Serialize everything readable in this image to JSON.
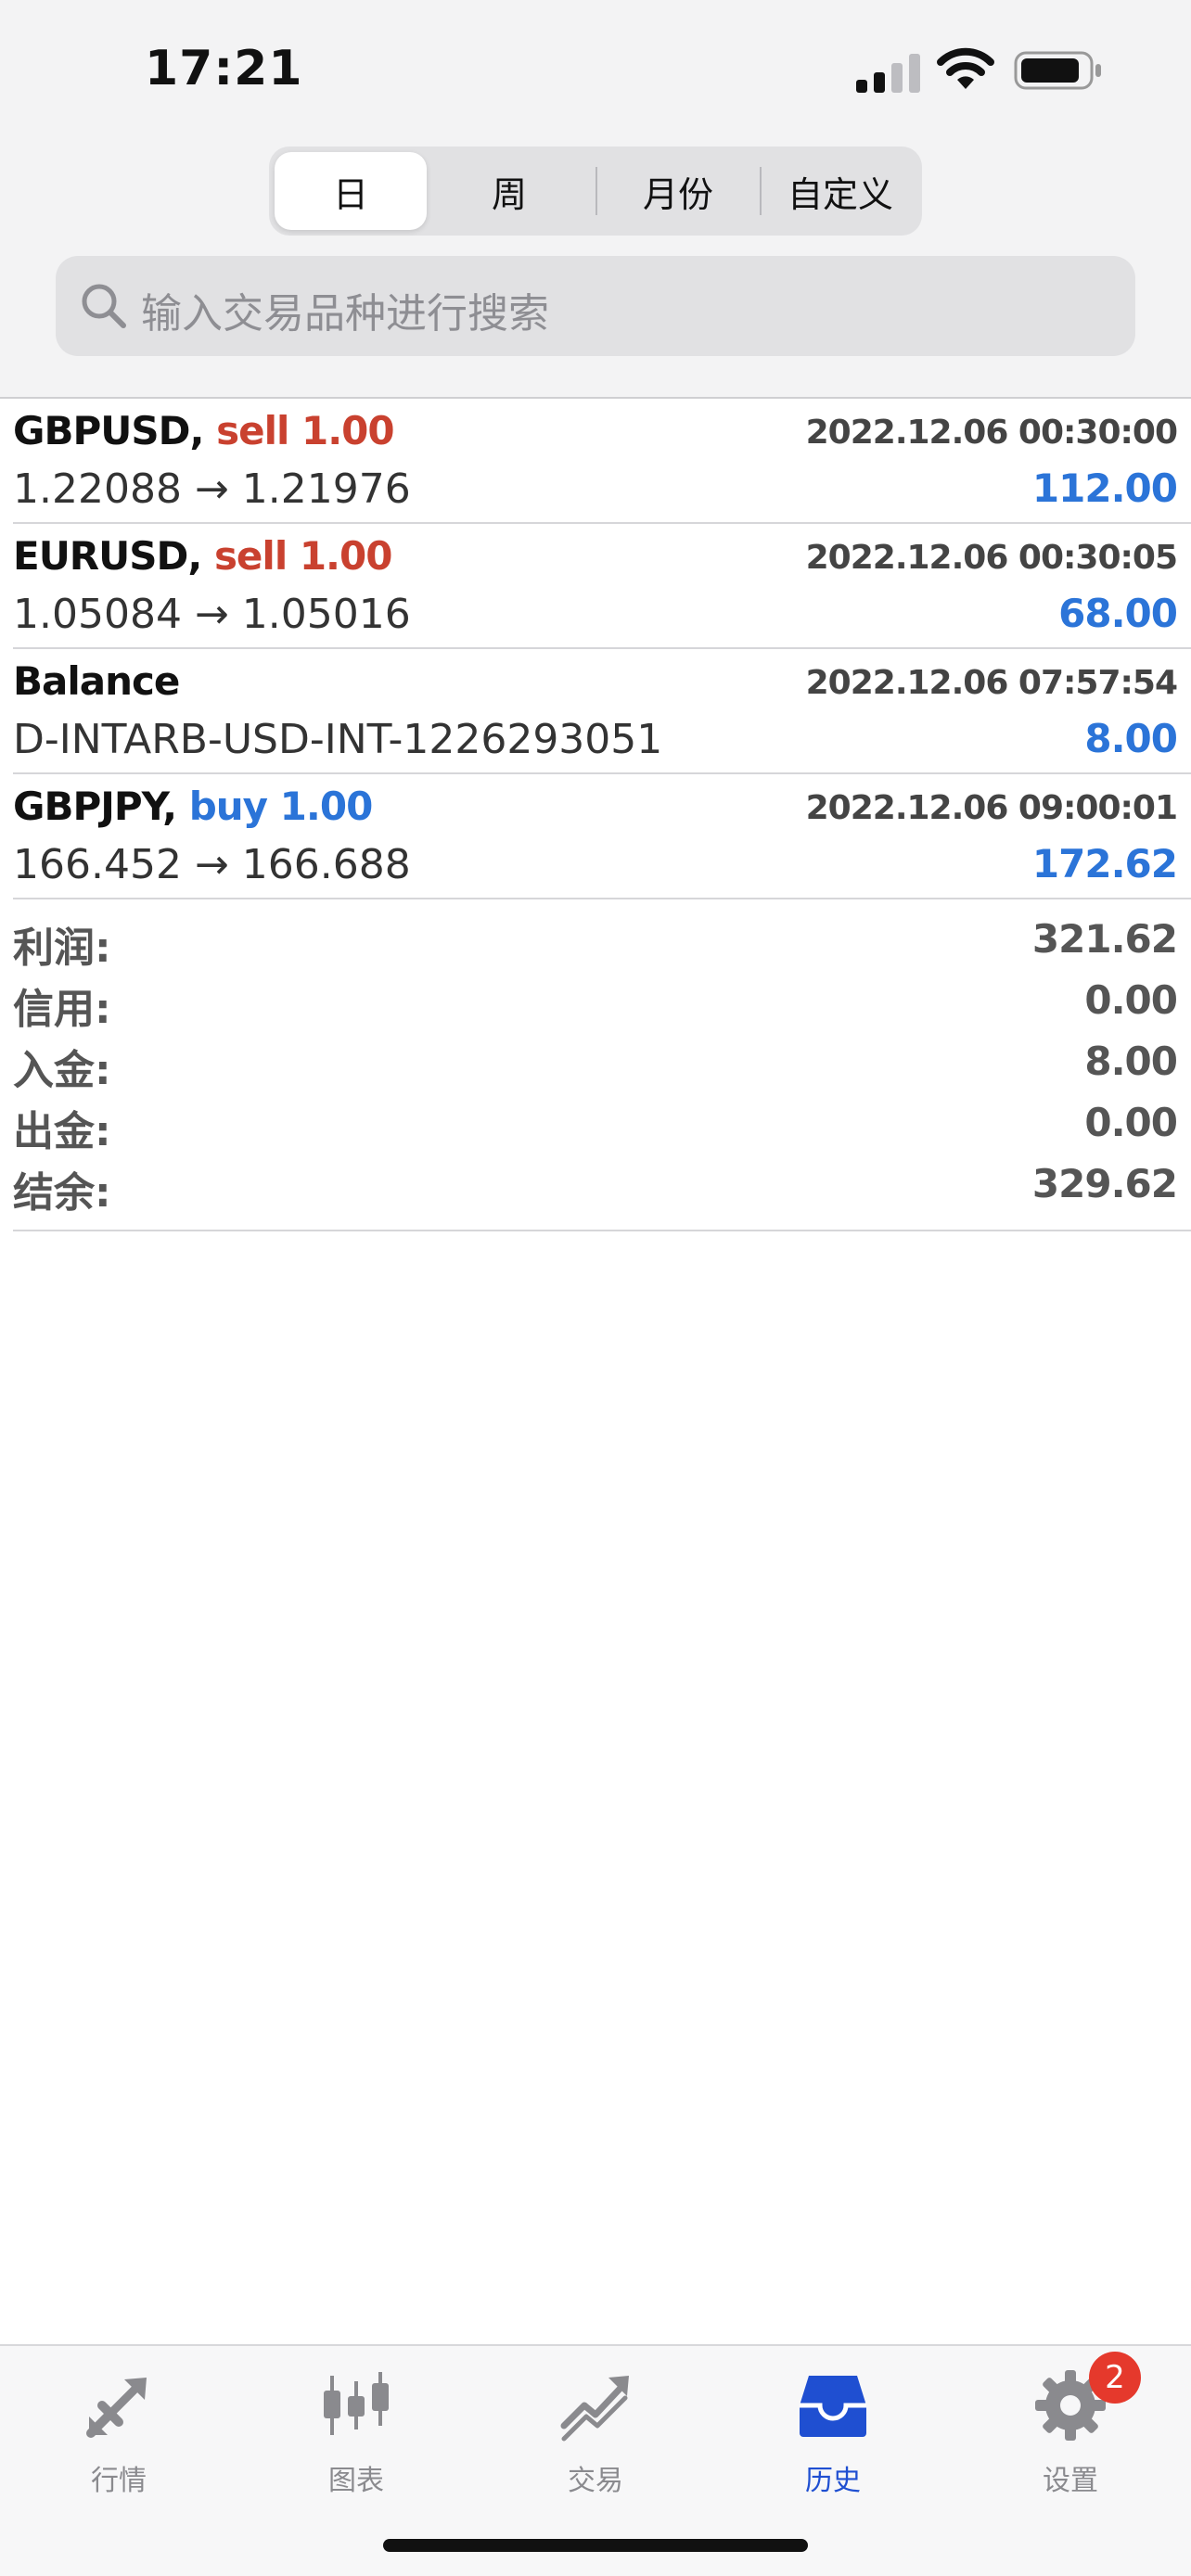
{
  "status_bar": {
    "time": "17:21"
  },
  "segments": [
    "日",
    "周",
    "月份",
    "自定义"
  ],
  "search": {
    "placeholder": "输入交易品种进行搜索"
  },
  "deals": [
    {
      "symbol": "GBPUSD,",
      "side": "sell 1.00",
      "side_type": "sell",
      "time": "2022.12.06 00:30:00",
      "detail": "1.22088 → 1.21976",
      "amount": "112.00"
    },
    {
      "symbol": "EURUSD,",
      "side": "sell 1.00",
      "side_type": "sell",
      "time": "2022.12.06 00:30:05",
      "detail": "1.05084 → 1.05016",
      "amount": "68.00"
    },
    {
      "symbol": "Balance",
      "side": "",
      "side_type": "none",
      "time": "2022.12.06 07:57:54",
      "detail": "D-INTARB-USD-INT-1226293051",
      "amount": "8.00"
    },
    {
      "symbol": "GBPJPY,",
      "side": "buy 1.00",
      "side_type": "buy",
      "time": "2022.12.06 09:00:01",
      "detail": "166.452 → 166.688",
      "amount": "172.62"
    }
  ],
  "summary": [
    {
      "label": "利润:",
      "value": "321.62"
    },
    {
      "label": "信用:",
      "value": "0.00"
    },
    {
      "label": "入金:",
      "value": "8.00"
    },
    {
      "label": "出金:",
      "value": "0.00"
    },
    {
      "label": "结余:",
      "value": "329.62"
    }
  ],
  "tabbar": {
    "items": [
      {
        "label": "行情",
        "icon": "quotes-arrows-icon"
      },
      {
        "label": "图表",
        "icon": "candlestick-chart-icon"
      },
      {
        "label": "交易",
        "icon": "trade-chart-icon"
      },
      {
        "label": "历史",
        "icon": "history-inbox-icon",
        "active": true
      },
      {
        "label": "设置",
        "icon": "gear-icon"
      }
    ],
    "settings_badge": "2"
  },
  "colors": {
    "sell": "#c9412f",
    "buy": "#2b74d8",
    "profit": "#2b74d8",
    "active_tab": "#1f4fd1",
    "badge": "#e5392c"
  }
}
